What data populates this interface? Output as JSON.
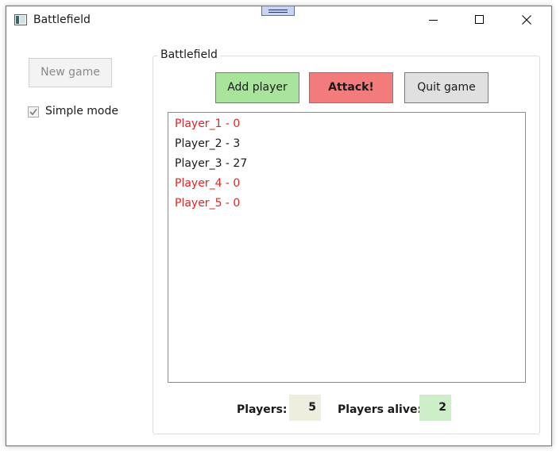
{
  "window": {
    "title": "Battlefield"
  },
  "sidebar": {
    "new_game_label": "New game",
    "simple_mode_label": "Simple mode",
    "simple_mode_checked": true
  },
  "group": {
    "title": "Battlefield",
    "buttons": {
      "add_player": "Add player",
      "attack": "Attack!",
      "quit_game": "Quit game"
    },
    "players": [
      {
        "label": "Player_1 - 0",
        "status": "dead"
      },
      {
        "label": "Player_2 - 3",
        "status": "alive"
      },
      {
        "label": "Player_3 - 27",
        "status": "alive"
      },
      {
        "label": "Player_4 - 0",
        "status": "dead"
      },
      {
        "label": "Player_5 - 0",
        "status": "dead"
      }
    ],
    "stats": {
      "players_label": "Players:",
      "players_value": "5",
      "alive_label": "Players alive:",
      "alive_value": "2"
    }
  },
  "colors": {
    "add_button": "#a8e49c",
    "attack_button": "#f27b7b",
    "quit_button": "#e0e0e0",
    "dead_player_text": "#e02424",
    "players_value_bg": "#eeeedf",
    "alive_value_bg": "#cdeec8"
  }
}
